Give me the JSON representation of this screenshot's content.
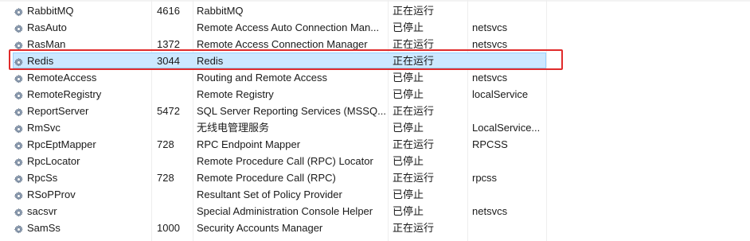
{
  "services": [
    {
      "name": "RabbitMQ",
      "pid": "4616",
      "description": "RabbitMQ",
      "status": "正在运行",
      "group": ""
    },
    {
      "name": "RasAuto",
      "pid": "",
      "description": "Remote Access Auto Connection Man...",
      "status": "已停止",
      "group": "netsvcs"
    },
    {
      "name": "RasMan",
      "pid": "1372",
      "description": "Remote Access Connection Manager",
      "status": "正在运行",
      "group": "netsvcs"
    },
    {
      "name": "Redis",
      "pid": "3044",
      "description": "Redis",
      "status": "正在运行",
      "group": "",
      "selected": true
    },
    {
      "name": "RemoteAccess",
      "pid": "",
      "description": "Routing and Remote Access",
      "status": "已停止",
      "group": "netsvcs"
    },
    {
      "name": "RemoteRegistry",
      "pid": "",
      "description": "Remote Registry",
      "status": "已停止",
      "group": "localService"
    },
    {
      "name": "ReportServer",
      "pid": "5472",
      "description": "SQL Server Reporting Services (MSSQ...",
      "status": "正在运行",
      "group": ""
    },
    {
      "name": "RmSvc",
      "pid": "",
      "description": "无线电管理服务",
      "status": "已停止",
      "group": "LocalService..."
    },
    {
      "name": "RpcEptMapper",
      "pid": "728",
      "description": "RPC Endpoint Mapper",
      "status": "正在运行",
      "group": "RPCSS"
    },
    {
      "name": "RpcLocator",
      "pid": "",
      "description": "Remote Procedure Call (RPC) Locator",
      "status": "已停止",
      "group": ""
    },
    {
      "name": "RpcSs",
      "pid": "728",
      "description": "Remote Procedure Call (RPC)",
      "status": "正在运行",
      "group": "rpcss"
    },
    {
      "name": "RSoPProv",
      "pid": "",
      "description": "Resultant Set of Policy Provider",
      "status": "已停止",
      "group": ""
    },
    {
      "name": "sacsvr",
      "pid": "",
      "description": "Special Administration Console Helper",
      "status": "已停止",
      "group": "netsvcs"
    },
    {
      "name": "SamSs",
      "pid": "1000",
      "description": "Security Accounts Manager",
      "status": "正在运行",
      "group": ""
    }
  ],
  "colors": {
    "selection_fill": "#cce8ff",
    "selection_border": "#99d1ff",
    "annotation_red": "#e02b2b"
  },
  "icons": {
    "service": "gear-icon"
  }
}
